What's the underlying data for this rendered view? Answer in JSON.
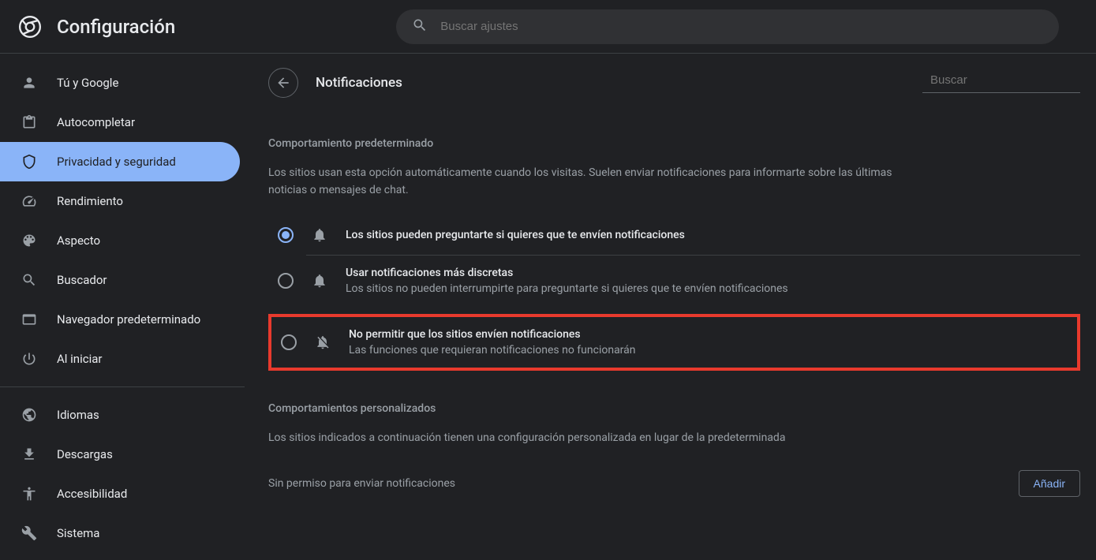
{
  "header": {
    "title": "Configuración",
    "search_placeholder": "Buscar ajustes"
  },
  "sidebar": {
    "items": [
      {
        "label": "Tú y Google"
      },
      {
        "label": "Autocompletar"
      },
      {
        "label": "Privacidad y seguridad"
      },
      {
        "label": "Rendimiento"
      },
      {
        "label": "Aspecto"
      },
      {
        "label": "Buscador"
      },
      {
        "label": "Navegador predeterminado"
      },
      {
        "label": "Al iniciar"
      },
      {
        "label": "Idiomas"
      },
      {
        "label": "Descargas"
      },
      {
        "label": "Accesibilidad"
      },
      {
        "label": "Sistema"
      }
    ]
  },
  "content": {
    "page_title": "Notificaciones",
    "search_placeholder": "Buscar",
    "default_behavior": {
      "title": "Comportamiento predeterminado",
      "description": "Los sitios usan esta opción automáticamente cuando los visitas. Suelen enviar notificaciones para informarte sobre las últimas noticias o mensajes de chat."
    },
    "options": [
      {
        "label": "Los sitios pueden preguntarte si quieres que te envíen notificaciones",
        "sub": ""
      },
      {
        "label": "Usar notificaciones más discretas",
        "sub": "Los sitios no pueden interrumpirte para preguntarte si quieres que te envíen notificaciones"
      },
      {
        "label": "No permitir que los sitios envíen notificaciones",
        "sub": "Las funciones que requieran notificaciones no funcionarán"
      }
    ],
    "custom": {
      "title": "Comportamientos personalizados",
      "description": "Los sitios indicados a continuación tienen una configuración personalizada en lugar de la predeterminada",
      "no_permission_label": "Sin permiso para enviar notificaciones",
      "add_button": "Añadir"
    }
  }
}
